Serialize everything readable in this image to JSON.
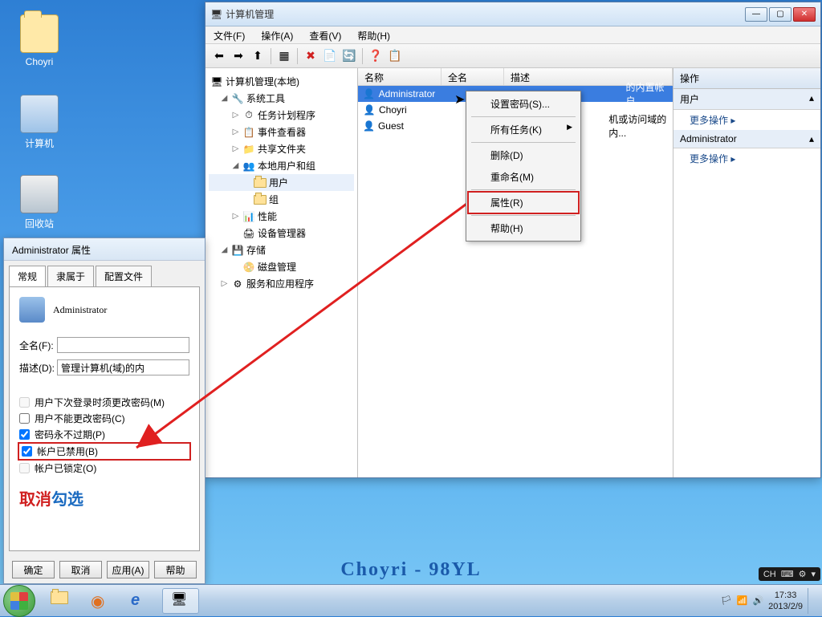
{
  "desktop": {
    "icons": [
      {
        "label": "Choyri",
        "type": "folder"
      },
      {
        "label": "计算机",
        "type": "computer"
      },
      {
        "label": "回收站",
        "type": "recycle"
      }
    ]
  },
  "mgmt_window": {
    "title": "计算机管理",
    "menu": [
      "文件(F)",
      "操作(A)",
      "查看(V)",
      "帮助(H)"
    ],
    "tree": {
      "root": "计算机管理(本地)",
      "sys_tools": "系统工具",
      "task_sched": "任务计划程序",
      "event_viewer": "事件查看器",
      "shared": "共享文件夹",
      "local_users": "本地用户和组",
      "users": "用户",
      "groups": "组",
      "perf": "性能",
      "devmgr": "设备管理器",
      "storage": "存储",
      "diskmgr": "磁盘管理",
      "services": "服务和应用程序"
    },
    "list": {
      "cols": {
        "name": "名称",
        "fullname": "全名",
        "desc": "描述"
      },
      "rows": [
        {
          "name": "Administrator",
          "desc": "的内置帐户"
        },
        {
          "name": "Choyri",
          "desc": ""
        },
        {
          "name": "Guest",
          "desc": "机或访问域的内..."
        }
      ]
    },
    "actions": {
      "header": "操作",
      "user_header": "用户",
      "more": "更多操作",
      "admin_header": "Administrator"
    },
    "context": {
      "setpwd": "设置密码(S)...",
      "alltasks": "所有任务(K)",
      "delete": "删除(D)",
      "rename": "重命名(M)",
      "props": "属性(R)",
      "help": "帮助(H)"
    }
  },
  "props_dialog": {
    "title": "Administrator 属性",
    "tabs": [
      "常规",
      "隶属于",
      "配置文件"
    ],
    "username": "Administrator",
    "fullname_label": "全名(F):",
    "desc_label": "描述(D):",
    "desc_value": "管理计算机(域)的内",
    "checks": {
      "must_change": "用户下次登录时须更改密码(M)",
      "cannot_change": "用户不能更改密码(C)",
      "never_expire": "密码永不过期(P)",
      "disabled": "帐户已禁用(B)",
      "locked": "帐户已锁定(O)"
    },
    "cancel_text_red": "取消",
    "cancel_text_blue": "勾选",
    "buttons": {
      "ok": "确定",
      "cancel": "取消",
      "apply": "应用(A)",
      "help": "帮助"
    }
  },
  "taskbar": {
    "lang": "CH",
    "time": "17:33",
    "date": "2013/2/9"
  },
  "watermark": "Choyri - 98YL"
}
